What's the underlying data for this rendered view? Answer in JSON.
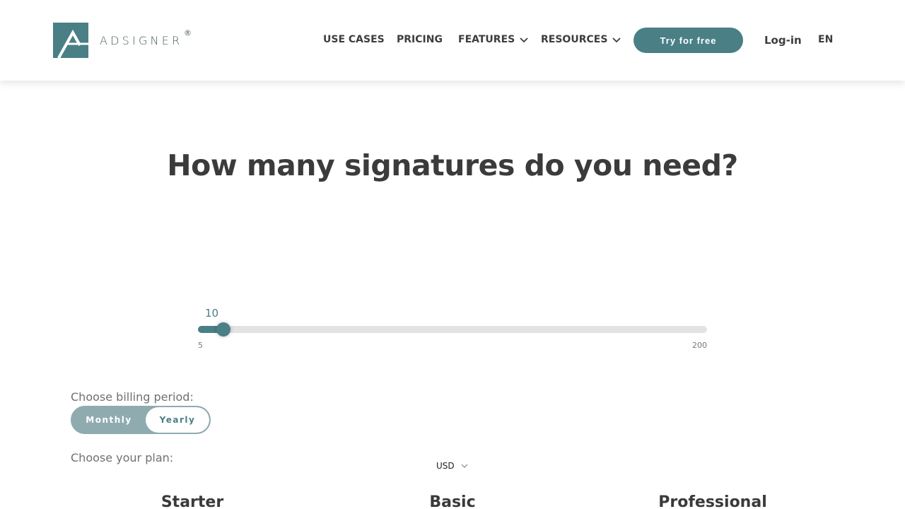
{
  "brand": {
    "name": "ADSIGNER",
    "registered": "®",
    "color": "#4a7f86"
  },
  "nav": {
    "use_cases": "USE CASES",
    "pricing": "PRICING",
    "features": "FEATURES",
    "resources": "RESOURCES",
    "cta": "Try for free",
    "login": "Log-in",
    "language": "EN"
  },
  "main": {
    "headline": "How many signatures do you need?",
    "slider": {
      "value": "10",
      "min": "5",
      "max": "200",
      "value_num": 10,
      "min_num": 5,
      "max_num": 200
    },
    "billing": {
      "label": "Choose billing period:",
      "monthly": "Monthly",
      "yearly": "Yearly",
      "selected": "Yearly"
    },
    "plan_label": "Choose your plan:",
    "currency": "USD",
    "plans": [
      "Starter",
      "Basic",
      "Professional"
    ]
  }
}
